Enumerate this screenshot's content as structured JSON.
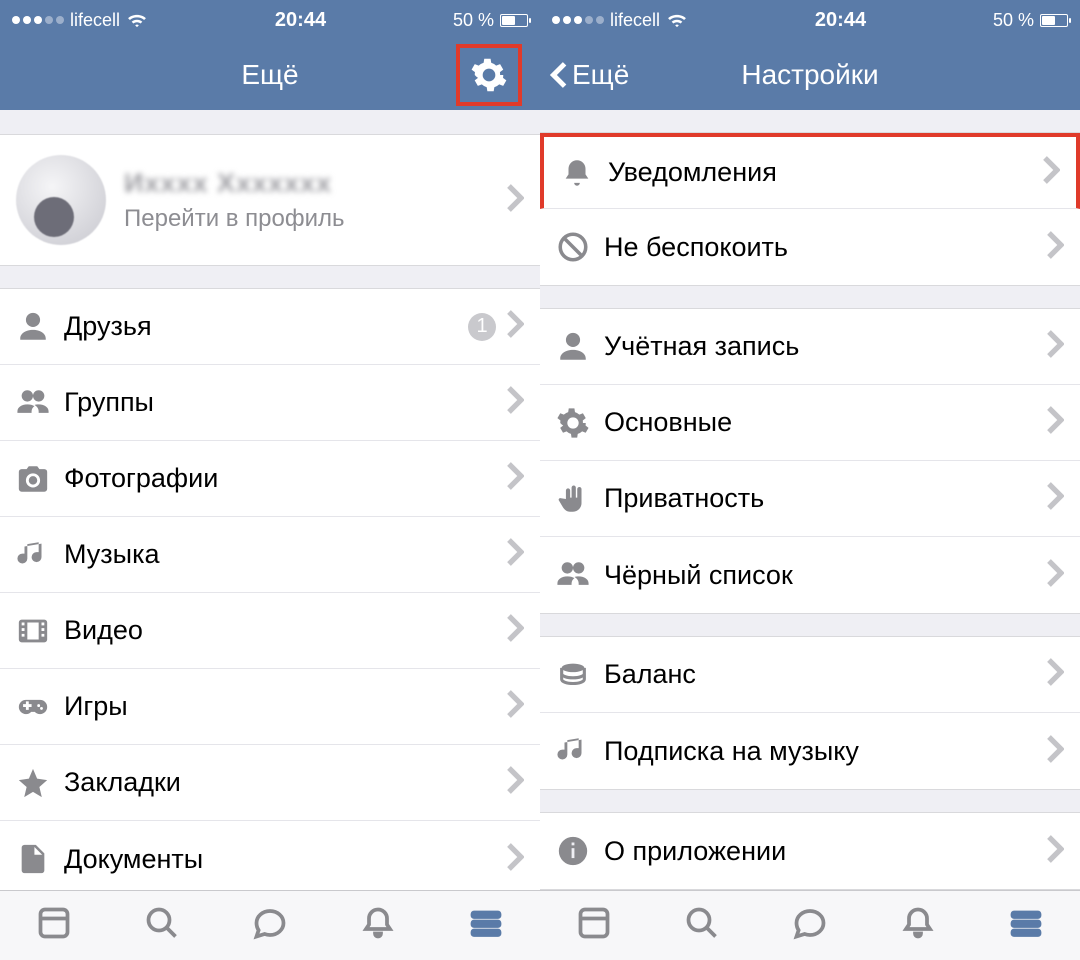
{
  "statusbar": {
    "carrier": "lifecell",
    "time": "20:44",
    "battery_text": "50 %"
  },
  "left": {
    "title": "Ещё",
    "profile": {
      "name_blur": "———",
      "subtitle": "Перейти в профиль"
    },
    "menu": {
      "friends": {
        "label": "Друзья",
        "badge": "1"
      },
      "groups": {
        "label": "Группы"
      },
      "photos": {
        "label": "Фотографии"
      },
      "music": {
        "label": "Музыка"
      },
      "video": {
        "label": "Видео"
      },
      "games": {
        "label": "Игры"
      },
      "bookmarks": {
        "label": "Закладки"
      },
      "documents": {
        "label": "Документы"
      }
    }
  },
  "right": {
    "back_label": "Ещё",
    "title": "Настройки",
    "groups": {
      "g1": {
        "notifications": {
          "label": "Уведомления"
        },
        "dnd": {
          "label": "Не беспокоить"
        }
      },
      "g2": {
        "account": {
          "label": "Учётная запись"
        },
        "general": {
          "label": "Основные"
        },
        "privacy": {
          "label": "Приватность"
        },
        "blacklist": {
          "label": "Чёрный список"
        }
      },
      "g3": {
        "balance": {
          "label": "Баланс"
        },
        "music_sub": {
          "label": "Подписка на музыку"
        }
      },
      "g4": {
        "about": {
          "label": "О приложении"
        }
      }
    }
  }
}
